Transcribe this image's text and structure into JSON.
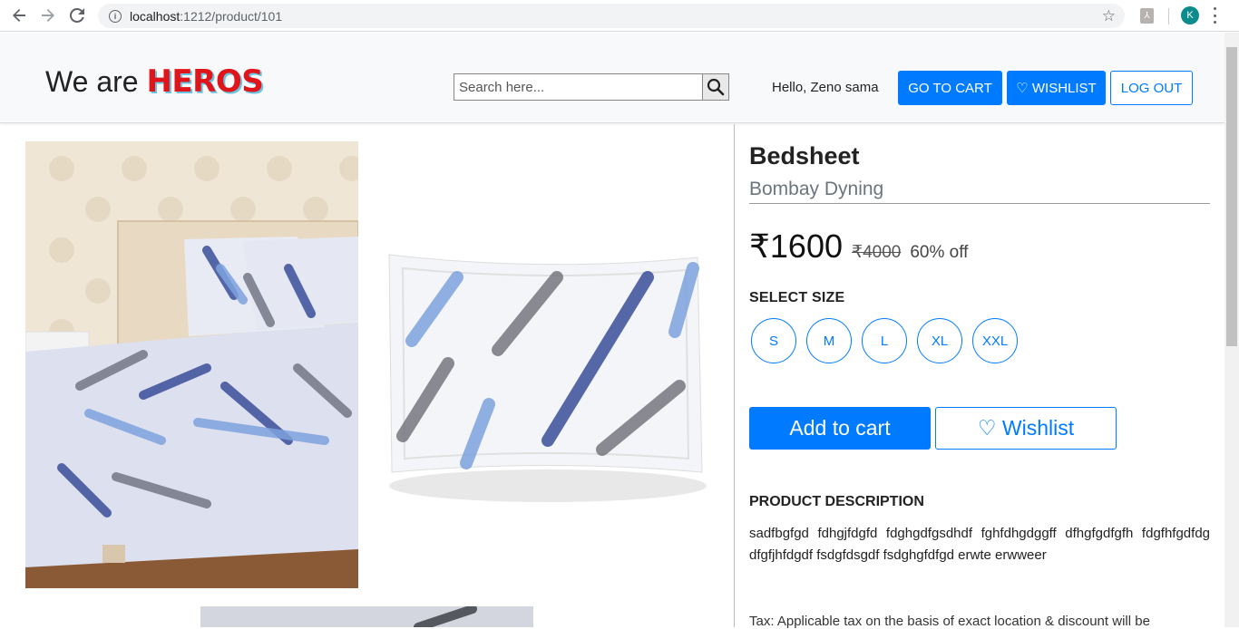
{
  "browser": {
    "url_host": "localhost",
    "url_path": ":1212/product/101",
    "profile_initial": "K"
  },
  "header": {
    "brand_prefix": "We are",
    "brand_highlight": "HEROS",
    "search_placeholder": "Search here...",
    "greeting": "Hello, Zeno sama",
    "go_to_cart": "GO TO CART",
    "wishlist": "♡ WISHLIST",
    "logout": "LOG OUT"
  },
  "product": {
    "name": "Bedsheet",
    "brand": "Bombay Dyning",
    "price": "₹1600",
    "mrp": "₹4000",
    "discount": "60% off",
    "size_label": "SELECT SIZE",
    "sizes": [
      "S",
      "M",
      "L",
      "XL",
      "XXL"
    ],
    "add_to_cart": "Add to cart",
    "wishlist": "♡ Wishlist",
    "description_label": "PRODUCT DESCRIPTION",
    "description": "sadfbgfgd fdhgjfdgfd fdghgdfgsdhdf fghfdhgdggff dfhgfgdfgfh fdgfhfgdfdg dfgfjhfdgdf fsdgfdsgdf fsdghgfdfgd erwte erwweer",
    "tax_note": "Tax: Applicable tax on the basis of exact location & discount will be"
  },
  "colors": {
    "primary": "#007bff",
    "brand_red": "#e0151b",
    "brand_shadow": "#68c3e0"
  }
}
